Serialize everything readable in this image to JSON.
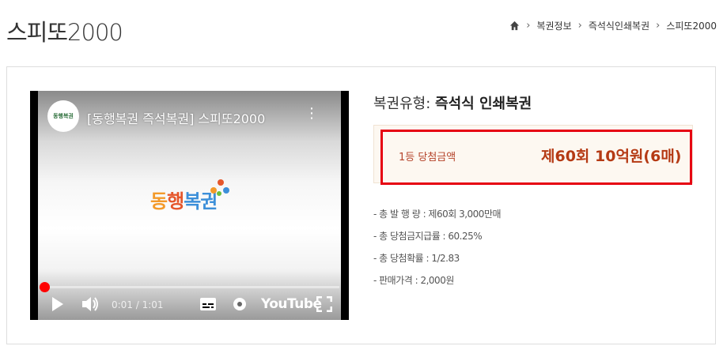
{
  "header": {
    "title": "스피또2000",
    "breadcrumb": [
      "복권정보",
      "즉석식인쇄복권",
      "스피또2000"
    ]
  },
  "video": {
    "title": "[동행복권 즉석복권] 스피또2000",
    "channel_logo_text": "동행복권",
    "logo_text_parts": [
      "동",
      "행",
      "복권"
    ],
    "time": "0:01 / 1:01",
    "brand": "YouTube",
    "progress": 0.016
  },
  "product": {
    "type_label": "복권유형: ",
    "type_value": "즉석식 인쇄복권",
    "prize_label": "1등 당첨금액",
    "prize_value": "제60회 10억원(6매)"
  },
  "info": [
    "- 총 발 행 량 : 제60회 3,000만매",
    "- 총 당첨금지급률 : 60.25%",
    "- 총 당첨확률 : 1/2.83",
    "- 판매가격 : 2,000원"
  ],
  "colors": {
    "accent_red": "#e60012",
    "prize_text": "#b53a14"
  }
}
